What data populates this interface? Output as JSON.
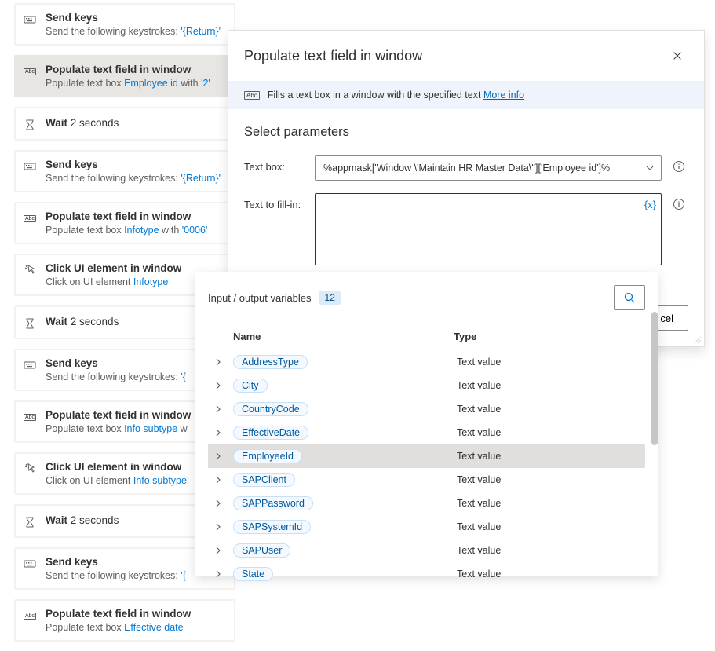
{
  "steps": [
    {
      "icon": "keyboard",
      "title": "Send keys",
      "sub_pre": "Send the following keystrokes: ",
      "sub_link": "'{Return}'"
    },
    {
      "icon": "abc",
      "title": "Populate text field in window",
      "sub_pre": "Populate text box ",
      "sub_link": "Employee id",
      "sub_post": " with ",
      "sub_link2": "'2'",
      "selected": true
    },
    {
      "icon": "wait",
      "title": "Wait",
      "sub_link": "2",
      "sub_post": " seconds",
      "compact": true
    },
    {
      "icon": "keyboard",
      "title": "Send keys",
      "sub_pre": "Send the following keystrokes: ",
      "sub_link": "'{Return}'"
    },
    {
      "icon": "abc",
      "title": "Populate text field in window",
      "sub_pre": "Populate text box ",
      "sub_link": "Infotype",
      "sub_post": " with ",
      "sub_link2": "'0006'"
    },
    {
      "icon": "click",
      "title": "Click UI element in window",
      "sub_pre": "Click on UI element ",
      "sub_link": "Infotype"
    },
    {
      "icon": "wait",
      "title": "Wait",
      "sub_link": "2",
      "sub_post": " seconds",
      "compact": true
    },
    {
      "icon": "keyboard",
      "title": "Send keys",
      "sub_pre": "Send the following keystrokes: ",
      "sub_link": "'{"
    },
    {
      "icon": "abc",
      "title": "Populate text field in window",
      "sub_pre": "Populate text box ",
      "sub_link": "Info subtype",
      "sub_post": " w"
    },
    {
      "icon": "click",
      "title": "Click UI element in window",
      "sub_pre": "Click on UI element ",
      "sub_link": "Info subtype"
    },
    {
      "icon": "wait",
      "title": "Wait",
      "sub_link": "2",
      "sub_post": " seconds",
      "compact": true
    },
    {
      "icon": "keyboard",
      "title": "Send keys",
      "sub_pre": "Send the following keystrokes: ",
      "sub_link": "'{"
    },
    {
      "icon": "abc",
      "title": "Populate text field in window",
      "sub_pre": "Populate text box ",
      "sub_link": "Effective date"
    }
  ],
  "dialog": {
    "title": "Populate text field in window",
    "info_text": "Fills a text box in a window with the specified text ",
    "info_link": "More info",
    "params_heading": "Select parameters",
    "label_textbox": "Text box:",
    "value_textbox": "%appmask['Window \\'Maintain HR Master Data\\'']['Employee id']%",
    "label_fillin": "Text to fill-in:",
    "var_token": "{x}",
    "btn_cancel": "cel"
  },
  "vars": {
    "heading": "Input / output variables",
    "count": "12",
    "col_name": "Name",
    "col_type": "Type",
    "rows": [
      {
        "name": "AddressType",
        "type": "Text value"
      },
      {
        "name": "City",
        "type": "Text value"
      },
      {
        "name": "CountryCode",
        "type": "Text value"
      },
      {
        "name": "EffectiveDate",
        "type": "Text value"
      },
      {
        "name": "EmployeeId",
        "type": "Text value",
        "sel": true
      },
      {
        "name": "SAPClient",
        "type": "Text value"
      },
      {
        "name": "SAPPassword",
        "type": "Text value"
      },
      {
        "name": "SAPSystemId",
        "type": "Text value"
      },
      {
        "name": "SAPUser",
        "type": "Text value"
      },
      {
        "name": "State",
        "type": "Text value"
      }
    ]
  }
}
